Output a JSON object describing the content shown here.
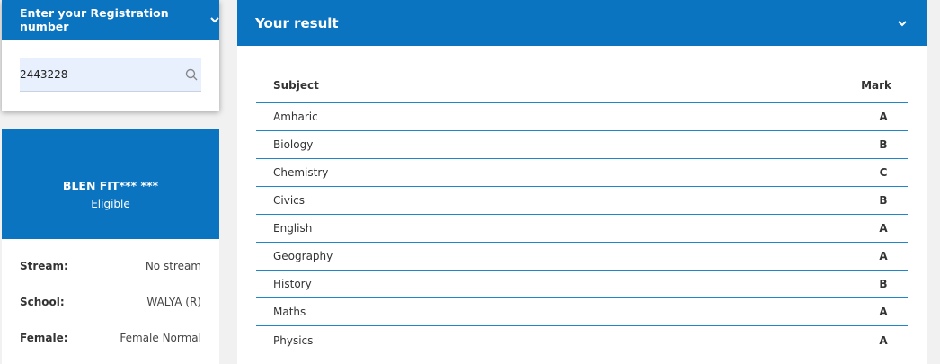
{
  "registration": {
    "header": "Enter your Registration number",
    "value": "2443228",
    "placeholder": ""
  },
  "student": {
    "name": "BLEN FIT*** ***",
    "status": "Eligible",
    "details": [
      {
        "label": "Stream:",
        "value": "No stream"
      },
      {
        "label": "School:",
        "value": "WALYA (R)"
      },
      {
        "label": "Female:",
        "value": "Female Normal"
      }
    ]
  },
  "result": {
    "title": "Your result",
    "columns": {
      "subject": "Subject",
      "mark": "Mark"
    },
    "rows": [
      {
        "subject": "Amharic",
        "mark": "A"
      },
      {
        "subject": "Biology",
        "mark": "B"
      },
      {
        "subject": "Chemistry",
        "mark": "C"
      },
      {
        "subject": "Civics",
        "mark": "B"
      },
      {
        "subject": "English",
        "mark": "A"
      },
      {
        "subject": "Geography",
        "mark": "A"
      },
      {
        "subject": "History",
        "mark": "B"
      },
      {
        "subject": "Maths",
        "mark": "A"
      },
      {
        "subject": "Physics",
        "mark": "A"
      }
    ]
  },
  "icons": {
    "chevron": "chevron-down-icon",
    "search": "search-icon"
  },
  "colors": {
    "accent": "#0a74c1",
    "divider": "#1e86c9"
  }
}
